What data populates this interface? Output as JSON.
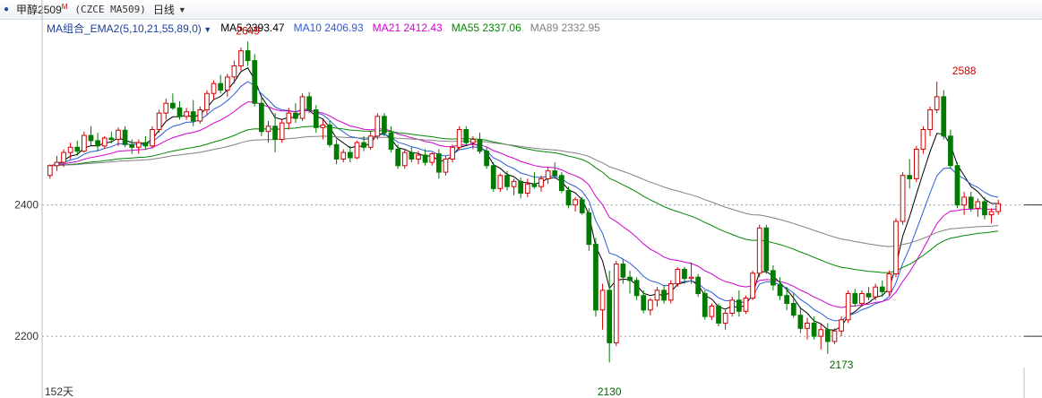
{
  "header": {
    "symbol": "甲醇2509",
    "symbol_mark": "M",
    "code": "(CZCE MA509)",
    "period": "日线",
    "arrow_icon": "chevron-down-icon"
  },
  "indicator": {
    "group_label": "MA组合_EMA2(5,10,21,55,89,0)",
    "items": [
      {
        "label": "MA5 2393.47",
        "color": "#000000"
      },
      {
        "label": "MA10 2406.93",
        "color": "#2a5bd7"
      },
      {
        "label": "MA21 2412.43",
        "color": "#d100d1"
      },
      {
        "label": "MA55 2337.06",
        "color": "#008800"
      },
      {
        "label": "MA89 2332.95",
        "color": "#808080"
      }
    ]
  },
  "footer": {
    "bar_count": "152天"
  },
  "chart_data": {
    "type": "candlestick",
    "y_ticks": [
      2200,
      2400
    ],
    "ylim": [
      2125,
      2655
    ],
    "up_color": "#d40000",
    "down_color": "#007a00",
    "candles": [
      [
        2445,
        2462,
        2440,
        2460
      ],
      [
        2460,
        2475,
        2452,
        2465
      ],
      [
        2465,
        2485,
        2458,
        2480
      ],
      [
        2480,
        2495,
        2470,
        2488
      ],
      [
        2488,
        2498,
        2475,
        2482
      ],
      [
        2482,
        2512,
        2480,
        2506
      ],
      [
        2506,
        2520,
        2490,
        2498
      ],
      [
        2498,
        2510,
        2482,
        2490
      ],
      [
        2490,
        2505,
        2486,
        2502
      ],
      [
        2502,
        2512,
        2494,
        2500
      ],
      [
        2500,
        2518,
        2490,
        2514
      ],
      [
        2514,
        2520,
        2488,
        2492
      ],
      [
        2492,
        2500,
        2478,
        2488
      ],
      [
        2488,
        2500,
        2478,
        2495
      ],
      [
        2495,
        2505,
        2484,
        2490
      ],
      [
        2490,
        2520,
        2486,
        2515
      ],
      [
        2515,
        2545,
        2510,
        2540
      ],
      [
        2540,
        2562,
        2530,
        2555
      ],
      [
        2555,
        2570,
        2545,
        2548
      ],
      [
        2548,
        2558,
        2530,
        2535
      ],
      [
        2535,
        2548,
        2530,
        2542
      ],
      [
        2542,
        2560,
        2520,
        2528
      ],
      [
        2528,
        2550,
        2524,
        2545
      ],
      [
        2545,
        2575,
        2538,
        2570
      ],
      [
        2570,
        2590,
        2560,
        2585
      ],
      [
        2585,
        2598,
        2570,
        2575
      ],
      [
        2575,
        2600,
        2565,
        2595
      ],
      [
        2595,
        2620,
        2585,
        2612
      ],
      [
        2612,
        2640,
        2605,
        2635
      ],
      [
        2635,
        2649,
        2612,
        2620
      ],
      [
        2620,
        2630,
        2550,
        2555
      ],
      [
        2555,
        2565,
        2505,
        2512
      ],
      [
        2512,
        2528,
        2495,
        2520
      ],
      [
        2520,
        2540,
        2480,
        2500
      ],
      [
        2500,
        2530,
        2495,
        2525
      ],
      [
        2525,
        2548,
        2515,
        2540
      ],
      [
        2540,
        2555,
        2525,
        2532
      ],
      [
        2532,
        2570,
        2528,
        2565
      ],
      [
        2565,
        2572,
        2540,
        2545
      ],
      [
        2545,
        2552,
        2510,
        2518
      ],
      [
        2518,
        2530,
        2500,
        2522
      ],
      [
        2522,
        2528,
        2488,
        2492
      ],
      [
        2492,
        2500,
        2462,
        2470
      ],
      [
        2470,
        2485,
        2465,
        2480
      ],
      [
        2480,
        2490,
        2465,
        2472
      ],
      [
        2472,
        2498,
        2470,
        2495
      ],
      [
        2495,
        2505,
        2482,
        2488
      ],
      [
        2488,
        2512,
        2484,
        2505
      ],
      [
        2505,
        2540,
        2500,
        2535
      ],
      [
        2535,
        2540,
        2505,
        2510
      ],
      [
        2510,
        2520,
        2480,
        2485
      ],
      [
        2485,
        2492,
        2455,
        2460
      ],
      [
        2460,
        2485,
        2455,
        2480
      ],
      [
        2480,
        2488,
        2465,
        2470
      ],
      [
        2470,
        2482,
        2462,
        2476
      ],
      [
        2476,
        2485,
        2460,
        2465
      ],
      [
        2465,
        2480,
        2460,
        2478
      ],
      [
        2478,
        2485,
        2440,
        2450
      ],
      [
        2450,
        2475,
        2445,
        2470
      ],
      [
        2470,
        2492,
        2465,
        2488
      ],
      [
        2488,
        2520,
        2484,
        2515
      ],
      [
        2515,
        2520,
        2490,
        2495
      ],
      [
        2495,
        2505,
        2485,
        2500
      ],
      [
        2500,
        2510,
        2478,
        2482
      ],
      [
        2482,
        2488,
        2455,
        2460
      ],
      [
        2460,
        2465,
        2420,
        2425
      ],
      [
        2425,
        2448,
        2420,
        2445
      ],
      [
        2445,
        2452,
        2422,
        2428
      ],
      [
        2428,
        2440,
        2415,
        2436
      ],
      [
        2436,
        2442,
        2410,
        2418
      ],
      [
        2418,
        2440,
        2412,
        2432
      ],
      [
        2432,
        2450,
        2425,
        2428
      ],
      [
        2428,
        2445,
        2420,
        2440
      ],
      [
        2440,
        2458,
        2432,
        2452
      ],
      [
        2452,
        2465,
        2440,
        2445
      ],
      [
        2445,
        2450,
        2418,
        2422
      ],
      [
        2422,
        2428,
        2395,
        2400
      ],
      [
        2400,
        2412,
        2390,
        2408
      ],
      [
        2408,
        2412,
        2385,
        2388
      ],
      [
        2388,
        2395,
        2330,
        2340
      ],
      [
        2340,
        2350,
        2230,
        2240
      ],
      [
        2240,
        2280,
        2210,
        2270
      ],
      [
        2270,
        2300,
        2160,
        2190
      ],
      [
        2190,
        2315,
        2185,
        2310
      ],
      [
        2310,
        2318,
        2280,
        2290
      ],
      [
        2290,
        2300,
        2265,
        2285
      ],
      [
        2285,
        2290,
        2255,
        2262
      ],
      [
        2262,
        2270,
        2235,
        2240
      ],
      [
        2240,
        2258,
        2232,
        2255
      ],
      [
        2255,
        2275,
        2245,
        2270
      ],
      [
        2270,
        2278,
        2250,
        2255
      ],
      [
        2255,
        2285,
        2250,
        2280
      ],
      [
        2280,
        2305,
        2275,
        2302
      ],
      [
        2302,
        2306,
        2280,
        2288
      ],
      [
        2288,
        2312,
        2280,
        2290
      ],
      [
        2290,
        2295,
        2260,
        2265
      ],
      [
        2265,
        2270,
        2225,
        2230
      ],
      [
        2230,
        2250,
        2225,
        2246
      ],
      [
        2246,
        2250,
        2215,
        2220
      ],
      [
        2220,
        2240,
        2210,
        2235
      ],
      [
        2235,
        2260,
        2230,
        2255
      ],
      [
        2255,
        2270,
        2230,
        2238
      ],
      [
        2238,
        2262,
        2234,
        2258
      ],
      [
        2258,
        2300,
        2255,
        2296
      ],
      [
        2296,
        2370,
        2290,
        2365
      ],
      [
        2365,
        2370,
        2295,
        2300
      ],
      [
        2300,
        2308,
        2270,
        2278
      ],
      [
        2278,
        2290,
        2255,
        2262
      ],
      [
        2262,
        2275,
        2240,
        2250
      ],
      [
        2250,
        2265,
        2228,
        2232
      ],
      [
        2232,
        2245,
        2205,
        2212
      ],
      [
        2212,
        2228,
        2195,
        2220
      ],
      [
        2220,
        2230,
        2195,
        2200
      ],
      [
        2200,
        2218,
        2180,
        2210
      ],
      [
        2210,
        2220,
        2173,
        2192
      ],
      [
        2192,
        2212,
        2188,
        2208
      ],
      [
        2208,
        2230,
        2200,
        2225
      ],
      [
        2225,
        2270,
        2220,
        2265
      ],
      [
        2265,
        2272,
        2245,
        2250
      ],
      [
        2250,
        2270,
        2245,
        2265
      ],
      [
        2265,
        2275,
        2255,
        2260
      ],
      [
        2260,
        2280,
        2255,
        2275
      ],
      [
        2275,
        2285,
        2260,
        2268
      ],
      [
        2268,
        2300,
        2262,
        2295
      ],
      [
        2295,
        2380,
        2290,
        2375
      ],
      [
        2375,
        2450,
        2370,
        2445
      ],
      [
        2445,
        2470,
        2425,
        2440
      ],
      [
        2440,
        2490,
        2435,
        2485
      ],
      [
        2485,
        2520,
        2478,
        2515
      ],
      [
        2515,
        2550,
        2505,
        2545
      ],
      [
        2545,
        2588,
        2540,
        2565
      ],
      [
        2565,
        2575,
        2500,
        2505
      ],
      [
        2505,
        2515,
        2455,
        2460
      ],
      [
        2460,
        2465,
        2395,
        2400
      ],
      [
        2400,
        2420,
        2385,
        2412
      ],
      [
        2412,
        2420,
        2390,
        2395
      ],
      [
        2395,
        2410,
        2382,
        2405
      ],
      [
        2405,
        2412,
        2378,
        2385
      ],
      [
        2385,
        2395,
        2372,
        2390
      ],
      [
        2390,
        2408,
        2385,
        2402
      ]
    ],
    "high_marks": [
      {
        "label": "2649",
        "index": 29,
        "value": 2649,
        "color": "#cc0000"
      },
      {
        "label": "2588",
        "index": 134,
        "value": 2588,
        "color": "#cc0000"
      }
    ],
    "low_marks": [
      {
        "label": "2130",
        "index": 82,
        "value": 2130,
        "color": "#006600"
      },
      {
        "label": "2173",
        "index": 116,
        "value": 2173,
        "color": "#006600"
      }
    ]
  }
}
